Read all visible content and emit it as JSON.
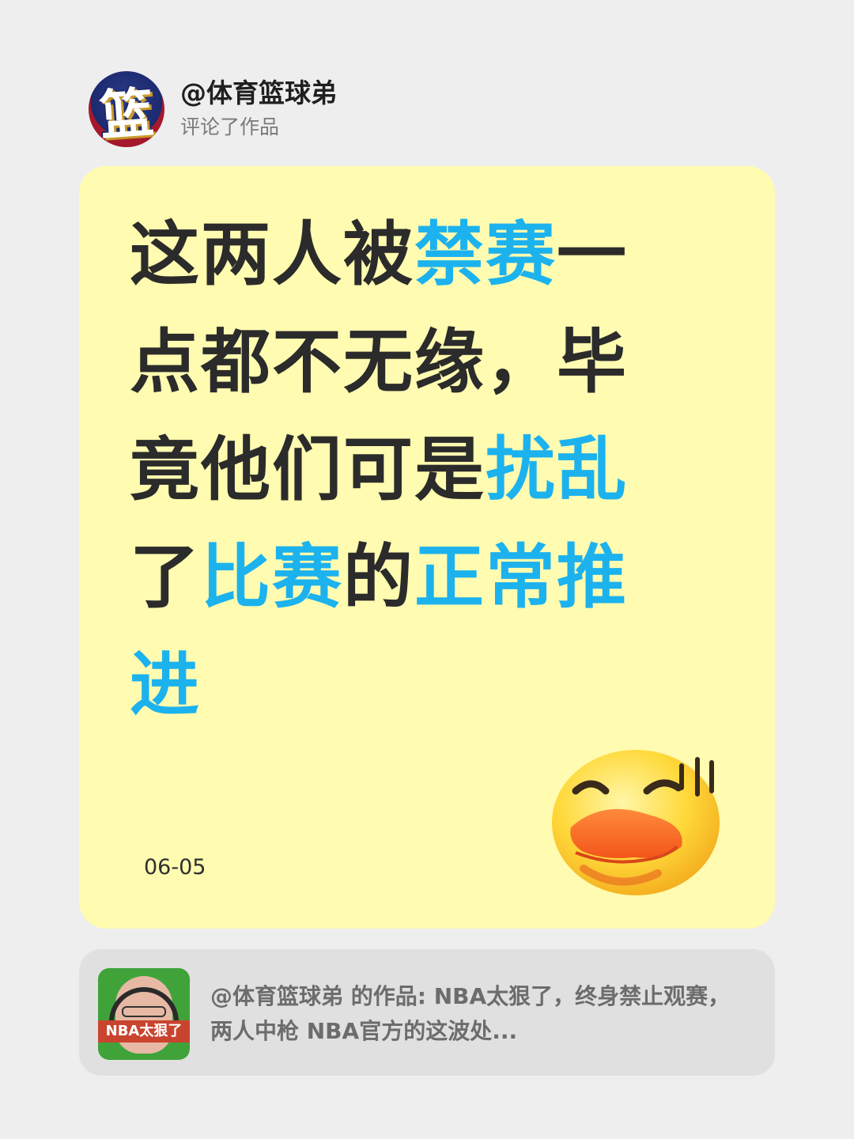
{
  "header": {
    "username": "@体育篮球弟",
    "action": "评论了作品",
    "avatar_glyph": "篮"
  },
  "comment": {
    "segments": [
      {
        "text": "这两人被",
        "highlight": false
      },
      {
        "text": "禁赛",
        "highlight": true
      },
      {
        "text": "一点都不无缘，毕竟他们可是",
        "highlight": false
      },
      {
        "text": "扰乱",
        "highlight": true
      },
      {
        "text": "了",
        "highlight": false
      },
      {
        "text": "比赛",
        "highlight": true
      },
      {
        "text": "的",
        "highlight": false
      },
      {
        "text": "正常推进",
        "highlight": true
      }
    ],
    "date": "06-05",
    "emoji_icon": "sweating-duck-face-emoji"
  },
  "reference": {
    "thumbnail_caption": "NBA太狠了",
    "text": "@体育篮球弟  的作品: NBA太狠了，终身禁止观赛，两人中枪 NBA官方的这波处..."
  },
  "colors": {
    "background": "#eeeeef",
    "card": "#fffbb0",
    "highlight": "#1cb2ee",
    "text": "#2b2b2b",
    "reference_card": "#e0e0e1"
  }
}
